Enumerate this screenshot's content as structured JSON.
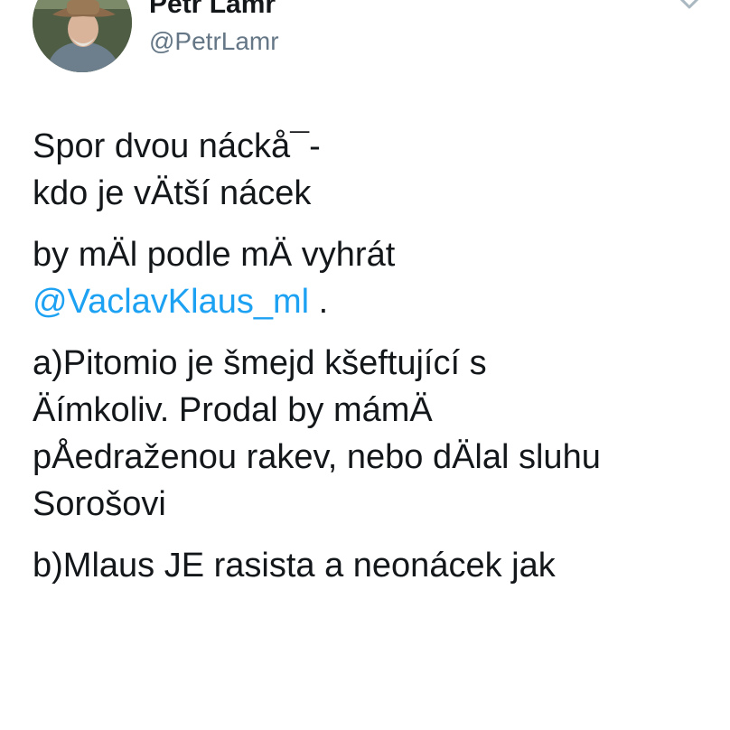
{
  "author": {
    "display_name": "Petr Lamr",
    "handle": "@PetrLamr",
    "avatar_icon": "profile-photo-avatar",
    "menu_icon": "chevron-down-icon"
  },
  "colors": {
    "text": "#14171a",
    "secondary": "#657786",
    "link": "#1da1f2"
  },
  "tweet": {
    "paragraphs": [
      {
        "lines": [
          "Spor dvou náckå¯-",
          "kdo je vÄtší nácek"
        ]
      },
      {
        "lines": [
          "by mÄl podle mÄ vyhrát"
        ],
        "mention": "@VaclavKlaus_ml",
        "after_mention": " ."
      },
      {
        "lines": [
          "a)Pitomio je šmejd kšeftující s",
          "Äímkoliv. Prodal by mámÄ",
          "pÅedraženou rakev, nebo dÄlal sluhu",
          "Sorošovi"
        ]
      },
      {
        "lines": [
          "b)Mlaus JE rasista a neonácek jak"
        ]
      }
    ]
  }
}
